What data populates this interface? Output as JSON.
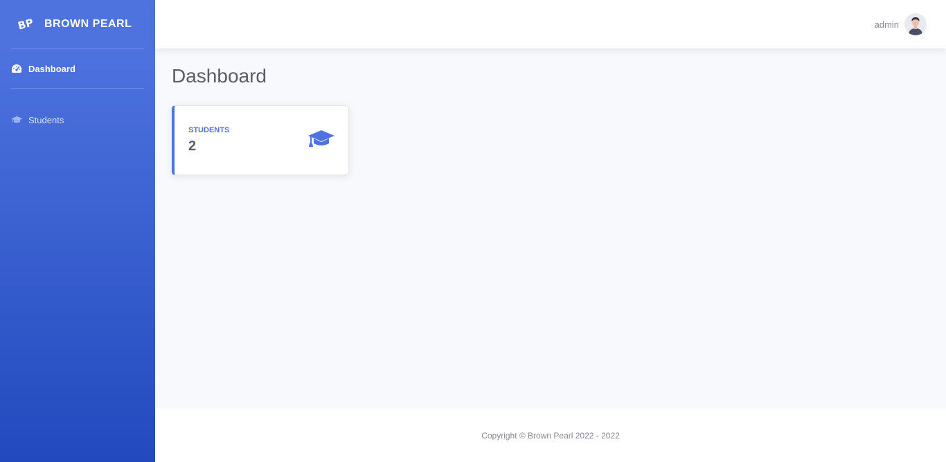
{
  "brand": {
    "logo": "BP",
    "name": "BROWN PEARL"
  },
  "sidebar": {
    "items": [
      {
        "label": "Dashboard",
        "icon": "tachometer-icon",
        "active": true
      },
      {
        "label": "Students",
        "icon": "graduation-cap-icon",
        "active": false
      }
    ]
  },
  "topbar": {
    "username": "admin",
    "avatar": "user-avatar"
  },
  "page": {
    "title": "Dashboard"
  },
  "cards": [
    {
      "label": "STUDENTS",
      "value": "2",
      "icon": "graduation-cap-icon"
    }
  ],
  "footer": {
    "copyright": "Copyright © Brown Pearl 2022 - 2022"
  },
  "colors": {
    "primary": "#4e73df",
    "primary_dark": "#224abe",
    "text_muted": "#858796",
    "text_dark": "#5a5c69",
    "background": "#f8f9fc"
  }
}
